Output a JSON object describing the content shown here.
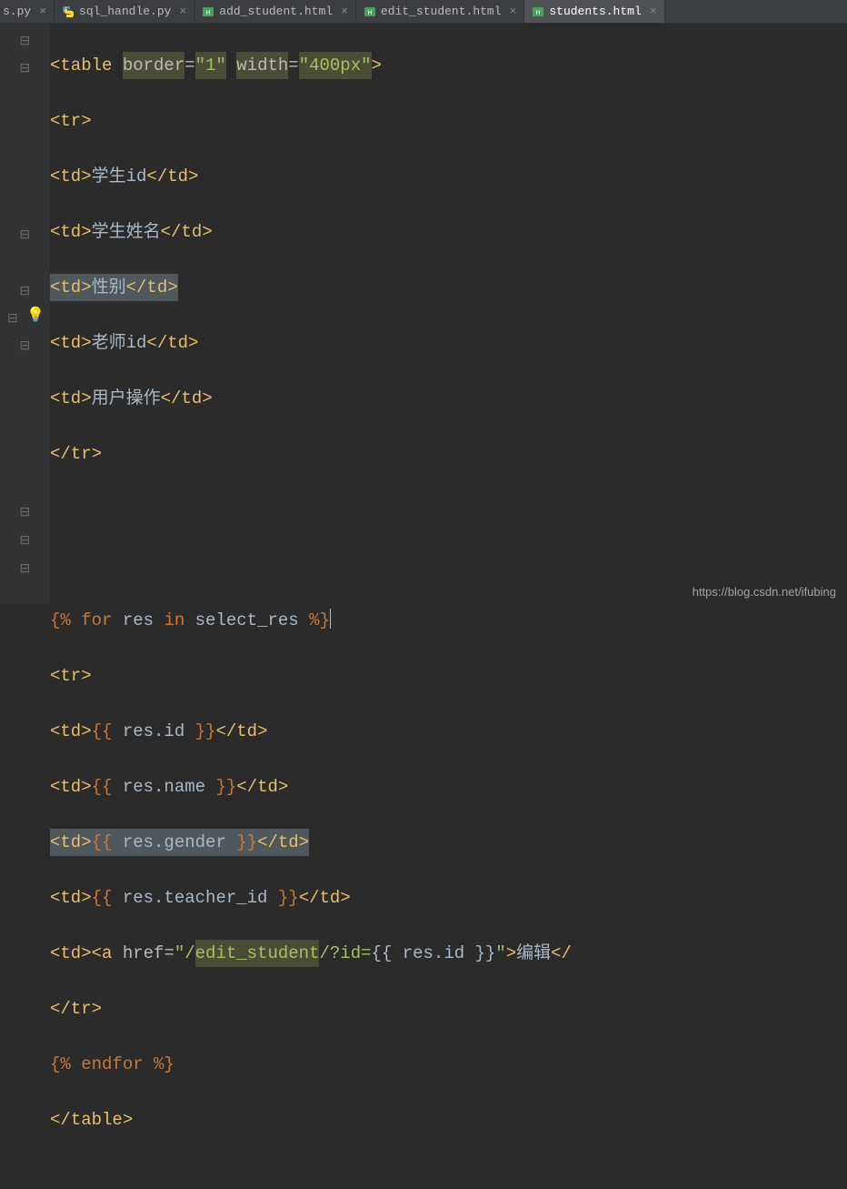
{
  "tabs": [
    {
      "label": "s.py",
      "icon": "python",
      "active": false,
      "partial": true
    },
    {
      "label": "sql_handle.py",
      "icon": "python",
      "active": false
    },
    {
      "label": "add_student.html",
      "icon": "html",
      "active": false
    },
    {
      "label": "edit_student.html",
      "icon": "html",
      "active": false
    },
    {
      "label": "students.html",
      "icon": "html",
      "active": true
    }
  ],
  "code": {
    "table_open_prefix": "<table ",
    "border_attr": "border",
    "border_val": "\"1\"",
    "width_attr": "width",
    "width_val": "\"400px\"",
    "tr_open": "<tr>",
    "tr_close": "</tr>",
    "td_open": "<td>",
    "td_close": "</td>",
    "header_cells": [
      "学生id",
      "学生姓名",
      "性别",
      "老师id",
      "用户操作"
    ],
    "for_open_l": "{% ",
    "for_kw": "for ",
    "for_var": "res ",
    "in_kw": "in ",
    "for_iter": "select_res ",
    "for_open_r": "%}",
    "var_open": "{{ ",
    "var_close": " }}",
    "row_vars": [
      "res.id",
      "res.name",
      "res.gender",
      "res.teacher_id"
    ],
    "a_open": "<a ",
    "href_attr": "href",
    "href_val_pre": "\"/",
    "href_path": "edit_student",
    "href_val_mid": "/?id=",
    "href_var": "{{ res.id }}",
    "href_val_end": "\"",
    "a_text": "编辑",
    "a_close": "</",
    "endfor": "{% endfor %}",
    "table_close": "</table>"
  },
  "watermark": "https://blog.csdn.net/ifubing"
}
